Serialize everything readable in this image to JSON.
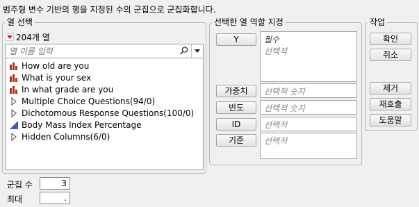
{
  "header": {
    "instruction": "범주형 변수 기반의 행을 지정된 수의 군집으로 군집화합니다."
  },
  "column_select": {
    "legend": "열 선택",
    "count_label": "204개 열",
    "search": {
      "placeholder": "열 이름 입력",
      "value": ""
    },
    "items": [
      {
        "label": "How old are you",
        "icon": "bar-chart-icon"
      },
      {
        "label": "What is your sex",
        "icon": "bar-chart-icon"
      },
      {
        "label": "In what grade are you",
        "icon": "bar-chart-icon"
      },
      {
        "label": "Multiple Choice Questions(94/0)",
        "icon": "expand-triangle-icon"
      },
      {
        "label": "Dichotomous Response Questions(100/0)",
        "icon": "expand-triangle-icon"
      },
      {
        "label": "Body Mass Index Percentage",
        "icon": "continuous-icon"
      },
      {
        "label": "Hidden Columns(6/0)",
        "icon": "expand-triangle-icon"
      }
    ]
  },
  "roles": {
    "legend": "선택한 열 역할 지정",
    "y": {
      "button": "Y",
      "required": "필수",
      "hint": "선택적"
    },
    "weight": {
      "button": "가중치",
      "hint": "선택적 숫자"
    },
    "freq": {
      "button": "빈도",
      "hint": "선택적 숫자"
    },
    "id": {
      "button": "ID",
      "hint": "선택적"
    },
    "by": {
      "button": "기준",
      "hint": "선택적"
    }
  },
  "actions": {
    "legend": "작업",
    "ok": "확인",
    "cancel": "취소",
    "remove": "제거",
    "recall": "재호출",
    "help": "도움말"
  },
  "options": {
    "clusters_label": "군집 수",
    "clusters_value": "3",
    "max_label": "최대",
    "max_value": "."
  },
  "colors": {
    "categorical_icon": "#b5301c",
    "continuous_icon": "#3a5dbd",
    "dropdown_red": "#d01515"
  }
}
